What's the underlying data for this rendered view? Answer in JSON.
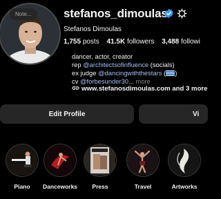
{
  "profile": {
    "note": "Note...",
    "username": "stefanos_dimoulas",
    "full_name": "Stefanos Dimoulas",
    "stats": {
      "posts_value": "1,755",
      "posts_label": "posts",
      "followers_value": "41.5K",
      "followers_label": "followers",
      "following_value": "3,488",
      "following_label": "followi"
    },
    "bio": {
      "line1": "dancer, actor, creator",
      "line2_prefix": "rep ",
      "line2_link": "@architectsofinfluence",
      "line2_suffix": " (socials)",
      "line3_prefix": "ex judge ",
      "line3_link": "@dancingwiththestars",
      "line3_open": " (",
      "line3_close": ")",
      "line4_prefix": "cv ",
      "line4_link": "@forbesunder30",
      "line4_ellipsis": "...",
      "line4_more": " more"
    },
    "website": "www.stefanosdimoulas.com and 3 more"
  },
  "actions": {
    "edit_profile": "Edit Profile",
    "view_partial": "Vi"
  },
  "highlights": [
    {
      "label": "Piano"
    },
    {
      "label": "Danceworks"
    },
    {
      "label": "Press"
    },
    {
      "label": "Travel"
    },
    {
      "label": "Artworks"
    }
  ],
  "icons": {
    "verified": "verified-badge-icon",
    "settings": "settings-gear-icon",
    "link": "link-icon"
  },
  "colors": {
    "background": "#000000",
    "verified_blue": "#3897f0",
    "link_text": "#a9bdf5",
    "button_bg": "#262626"
  }
}
